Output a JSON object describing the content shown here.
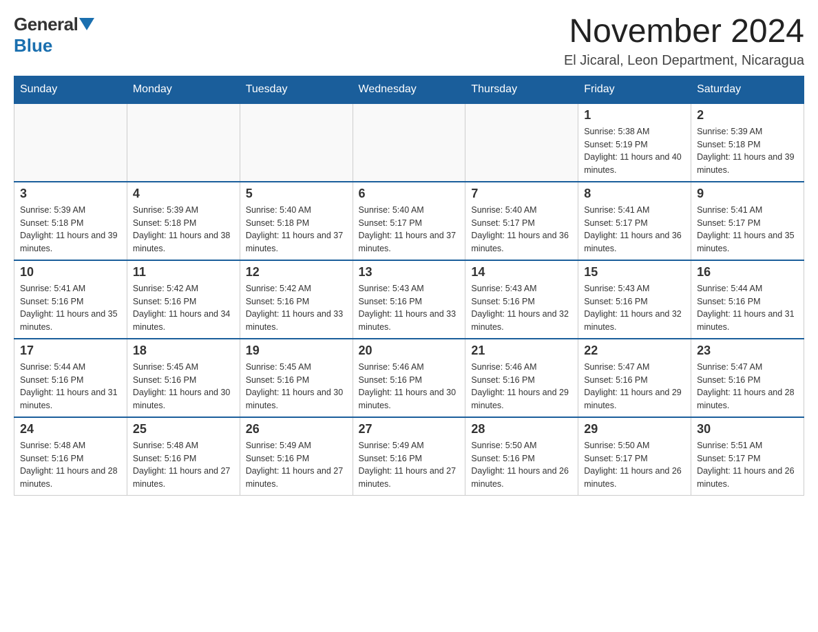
{
  "header": {
    "logo_general": "General",
    "logo_blue": "Blue",
    "month_title": "November 2024",
    "location": "El Jicaral, Leon Department, Nicaragua"
  },
  "weekdays": [
    "Sunday",
    "Monday",
    "Tuesday",
    "Wednesday",
    "Thursday",
    "Friday",
    "Saturday"
  ],
  "weeks": [
    [
      {
        "day": "",
        "info": ""
      },
      {
        "day": "",
        "info": ""
      },
      {
        "day": "",
        "info": ""
      },
      {
        "day": "",
        "info": ""
      },
      {
        "day": "",
        "info": ""
      },
      {
        "day": "1",
        "info": "Sunrise: 5:38 AM\nSunset: 5:19 PM\nDaylight: 11 hours and 40 minutes."
      },
      {
        "day": "2",
        "info": "Sunrise: 5:39 AM\nSunset: 5:18 PM\nDaylight: 11 hours and 39 minutes."
      }
    ],
    [
      {
        "day": "3",
        "info": "Sunrise: 5:39 AM\nSunset: 5:18 PM\nDaylight: 11 hours and 39 minutes."
      },
      {
        "day": "4",
        "info": "Sunrise: 5:39 AM\nSunset: 5:18 PM\nDaylight: 11 hours and 38 minutes."
      },
      {
        "day": "5",
        "info": "Sunrise: 5:40 AM\nSunset: 5:18 PM\nDaylight: 11 hours and 37 minutes."
      },
      {
        "day": "6",
        "info": "Sunrise: 5:40 AM\nSunset: 5:17 PM\nDaylight: 11 hours and 37 minutes."
      },
      {
        "day": "7",
        "info": "Sunrise: 5:40 AM\nSunset: 5:17 PM\nDaylight: 11 hours and 36 minutes."
      },
      {
        "day": "8",
        "info": "Sunrise: 5:41 AM\nSunset: 5:17 PM\nDaylight: 11 hours and 36 minutes."
      },
      {
        "day": "9",
        "info": "Sunrise: 5:41 AM\nSunset: 5:17 PM\nDaylight: 11 hours and 35 minutes."
      }
    ],
    [
      {
        "day": "10",
        "info": "Sunrise: 5:41 AM\nSunset: 5:16 PM\nDaylight: 11 hours and 35 minutes."
      },
      {
        "day": "11",
        "info": "Sunrise: 5:42 AM\nSunset: 5:16 PM\nDaylight: 11 hours and 34 minutes."
      },
      {
        "day": "12",
        "info": "Sunrise: 5:42 AM\nSunset: 5:16 PM\nDaylight: 11 hours and 33 minutes."
      },
      {
        "day": "13",
        "info": "Sunrise: 5:43 AM\nSunset: 5:16 PM\nDaylight: 11 hours and 33 minutes."
      },
      {
        "day": "14",
        "info": "Sunrise: 5:43 AM\nSunset: 5:16 PM\nDaylight: 11 hours and 32 minutes."
      },
      {
        "day": "15",
        "info": "Sunrise: 5:43 AM\nSunset: 5:16 PM\nDaylight: 11 hours and 32 minutes."
      },
      {
        "day": "16",
        "info": "Sunrise: 5:44 AM\nSunset: 5:16 PM\nDaylight: 11 hours and 31 minutes."
      }
    ],
    [
      {
        "day": "17",
        "info": "Sunrise: 5:44 AM\nSunset: 5:16 PM\nDaylight: 11 hours and 31 minutes."
      },
      {
        "day": "18",
        "info": "Sunrise: 5:45 AM\nSunset: 5:16 PM\nDaylight: 11 hours and 30 minutes."
      },
      {
        "day": "19",
        "info": "Sunrise: 5:45 AM\nSunset: 5:16 PM\nDaylight: 11 hours and 30 minutes."
      },
      {
        "day": "20",
        "info": "Sunrise: 5:46 AM\nSunset: 5:16 PM\nDaylight: 11 hours and 30 minutes."
      },
      {
        "day": "21",
        "info": "Sunrise: 5:46 AM\nSunset: 5:16 PM\nDaylight: 11 hours and 29 minutes."
      },
      {
        "day": "22",
        "info": "Sunrise: 5:47 AM\nSunset: 5:16 PM\nDaylight: 11 hours and 29 minutes."
      },
      {
        "day": "23",
        "info": "Sunrise: 5:47 AM\nSunset: 5:16 PM\nDaylight: 11 hours and 28 minutes."
      }
    ],
    [
      {
        "day": "24",
        "info": "Sunrise: 5:48 AM\nSunset: 5:16 PM\nDaylight: 11 hours and 28 minutes."
      },
      {
        "day": "25",
        "info": "Sunrise: 5:48 AM\nSunset: 5:16 PM\nDaylight: 11 hours and 27 minutes."
      },
      {
        "day": "26",
        "info": "Sunrise: 5:49 AM\nSunset: 5:16 PM\nDaylight: 11 hours and 27 minutes."
      },
      {
        "day": "27",
        "info": "Sunrise: 5:49 AM\nSunset: 5:16 PM\nDaylight: 11 hours and 27 minutes."
      },
      {
        "day": "28",
        "info": "Sunrise: 5:50 AM\nSunset: 5:16 PM\nDaylight: 11 hours and 26 minutes."
      },
      {
        "day": "29",
        "info": "Sunrise: 5:50 AM\nSunset: 5:17 PM\nDaylight: 11 hours and 26 minutes."
      },
      {
        "day": "30",
        "info": "Sunrise: 5:51 AM\nSunset: 5:17 PM\nDaylight: 11 hours and 26 minutes."
      }
    ]
  ]
}
